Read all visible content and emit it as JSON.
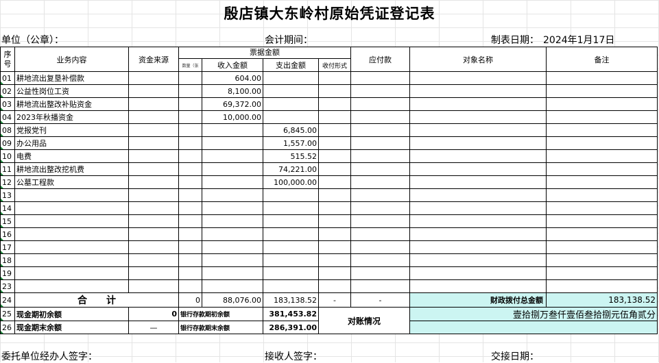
{
  "title": "殷店镇大东岭村原始凭证登记表",
  "meta": {
    "unit_label": "单位（公章）：",
    "period_label": "会计期间：",
    "date_label": "制表日期：",
    "date_value": "2024年1月17日"
  },
  "headers": {
    "seq": "序号",
    "business": "业务内容",
    "source": "资金来源",
    "bill_amount": "票据金额",
    "quantity": "数量（张",
    "income": "收入金额",
    "expense": "支出金额",
    "pay_form": "收付形式",
    "payable": "应付款",
    "target": "对象名称",
    "remark": "备注"
  },
  "rows": [
    {
      "seq": "01",
      "content": "耕地流出复垦补偿款",
      "income": "604.00",
      "expense": ""
    },
    {
      "seq": "02",
      "content": "公益性岗位工资",
      "income": "8,100.00",
      "expense": ""
    },
    {
      "seq": "03",
      "content": "耕地流出整改补贴资金",
      "income": "69,372.00",
      "expense": ""
    },
    {
      "seq": "04",
      "content": "2023年秋播资金",
      "income": "10,000.00",
      "expense": ""
    },
    {
      "seq": "08",
      "content": "党报党刊",
      "income": "",
      "expense": "6,845.00"
    },
    {
      "seq": "09",
      "content": "办公用品",
      "income": "",
      "expense": "1,557.00"
    },
    {
      "seq": "10",
      "content": "电费",
      "income": "",
      "expense": "515.52"
    },
    {
      "seq": "11",
      "content": "耕地流出整改挖机费",
      "income": "",
      "expense": "74,221.00"
    },
    {
      "seq": "12",
      "content": "公墓工程款",
      "income": "",
      "expense": "100,000.00"
    },
    {
      "seq": "13",
      "content": "",
      "income": "",
      "expense": ""
    },
    {
      "seq": "14",
      "content": "",
      "income": "",
      "expense": ""
    },
    {
      "seq": "15",
      "content": "",
      "income": "",
      "expense": ""
    },
    {
      "seq": "16",
      "content": "",
      "income": "",
      "expense": ""
    },
    {
      "seq": "17",
      "content": "",
      "income": "",
      "expense": ""
    },
    {
      "seq": "18",
      "content": "",
      "income": "",
      "expense": ""
    },
    {
      "seq": "19",
      "content": "",
      "income": "",
      "expense": ""
    },
    {
      "seq": "23",
      "content": "",
      "income": "",
      "expense": ""
    }
  ],
  "totals": {
    "seq": "24",
    "label": "合　　计",
    "quantity": "0",
    "income": "88,076.00",
    "expense": "183,138.52",
    "pay_form": "-",
    "payable": "-",
    "fiscal_label": "财政拨付总金额",
    "fiscal_amount": "183,138.52"
  },
  "cash": {
    "seq_begin": "25",
    "begin_label": "现金期初余额",
    "begin_value": "0",
    "bank_begin_label": "银行存款期初余额",
    "bank_begin_value": "381,453.82",
    "reconcile_label": "对账情况",
    "amount_in_words": "壹拾捌万叁仟壹佰叁拾捌元伍角贰分",
    "seq_end": "26",
    "end_label": "现金期末余额",
    "end_value": "—",
    "bank_end_label": "银行存款期末余额",
    "bank_end_value": "286,391.00"
  },
  "footer": {
    "agent_label": "委托单位经办人签字：",
    "receiver_label": "接收人签字：",
    "handover_label": "交接日期："
  }
}
